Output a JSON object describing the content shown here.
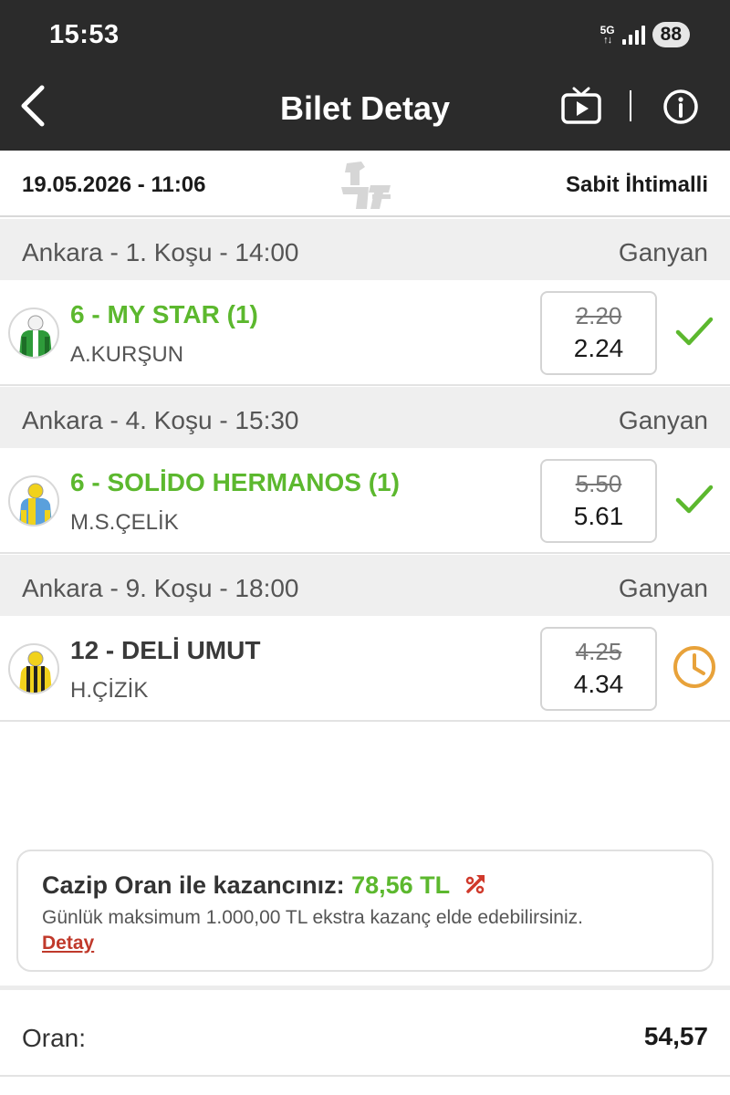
{
  "status_bar": {
    "time": "15:53",
    "network": "5G",
    "battery": "88"
  },
  "app_bar": {
    "title": "Bilet Detay",
    "icons": [
      "chevron-left-icon",
      "tv-icon",
      "info-icon"
    ]
  },
  "ticket": {
    "date_time": "19.05.2026 - 11:06",
    "type": "Sabit İhtimalli"
  },
  "races": [
    {
      "header": "Ankara - 1. Koşu - 14:00",
      "bet_type": "Ganyan",
      "runner": "6 - MY STAR (1)",
      "jockey": "A.KURŞUN",
      "odds_old": "2.20",
      "odds_new": "2.24",
      "status": "won",
      "status_icon": "check-icon"
    },
    {
      "header": "Ankara - 4. Koşu - 15:30",
      "bet_type": "Ganyan",
      "runner": "6 - SOLİDO HERMANOS (1)",
      "jockey": "M.S.ÇELİK",
      "odds_old": "5.50",
      "odds_new": "5.61",
      "status": "won",
      "status_icon": "check-icon"
    },
    {
      "header": "Ankara - 9. Koşu - 18:00",
      "bet_type": "Ganyan",
      "runner": "12 - DELİ UMUT",
      "jockey": "H.ÇİZİK",
      "odds_old": "4.25",
      "odds_new": "4.34",
      "status": "pending",
      "status_icon": "clock-icon"
    }
  ],
  "promo": {
    "label": "Cazip Oran ile kazancınız:",
    "amount": "78,56 TL",
    "description": "Günlük maksimum 1.000,00 TL ekstra kazanç elde edebilirsiniz.",
    "link": "Detay"
  },
  "summary": {
    "oran_label": "Oran:",
    "oran_value": "54,57"
  },
  "colors": {
    "header_bg": "#2b2b2b",
    "won_green": "#5cb82e",
    "pending_orange": "#e8a23a",
    "link_red": "#c0392b"
  }
}
